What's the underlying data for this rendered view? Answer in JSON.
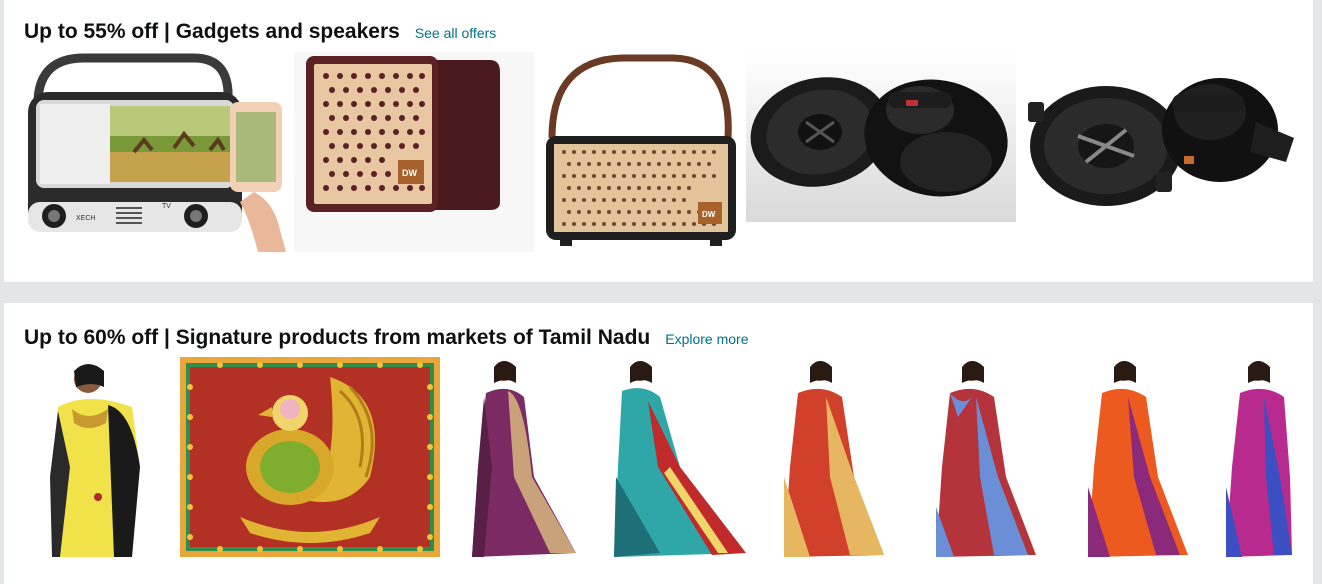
{
  "sections": [
    {
      "title": "Up to 55% off | Gadgets and speakers",
      "link": "See all offers",
      "products": [
        {
          "name": "tv-speaker-phone-stand",
          "brand_text": "XECH",
          "tv_text": "TV"
        },
        {
          "name": "wooden-cube-speaker",
          "logo_text": "DW"
        },
        {
          "name": "handle-speaker",
          "logo_text": "DW"
        },
        {
          "name": "car-coaxial-speaker-pair-1"
        },
        {
          "name": "car-coaxial-speaker-pair-2"
        }
      ]
    },
    {
      "title": "Up to 60% off | Signature products from markets of Tamil Nadu",
      "link": "Explore more",
      "products": [
        {
          "name": "saree-yellow-black",
          "color": "#f2e24a",
          "accent": "#1a1a1a"
        },
        {
          "name": "peacock-art-panel"
        },
        {
          "name": "saree-purple",
          "color": "#7b2a63",
          "accent": "#c9a27a"
        },
        {
          "name": "saree-teal-paithani",
          "color": "#2fa7a8",
          "accent": "#c02a2a"
        },
        {
          "name": "saree-red-gold",
          "color": "#d0402a",
          "accent": "#e6b760"
        },
        {
          "name": "saree-blue-red",
          "color": "#b5333b",
          "accent": "#6a8fd6"
        },
        {
          "name": "saree-orange",
          "color": "#ec5a1f",
          "accent": "#8b2a7a"
        },
        {
          "name": "saree-magenta-partial",
          "color": "#b82a8d",
          "accent": "#3b4fc2"
        }
      ]
    }
  ]
}
